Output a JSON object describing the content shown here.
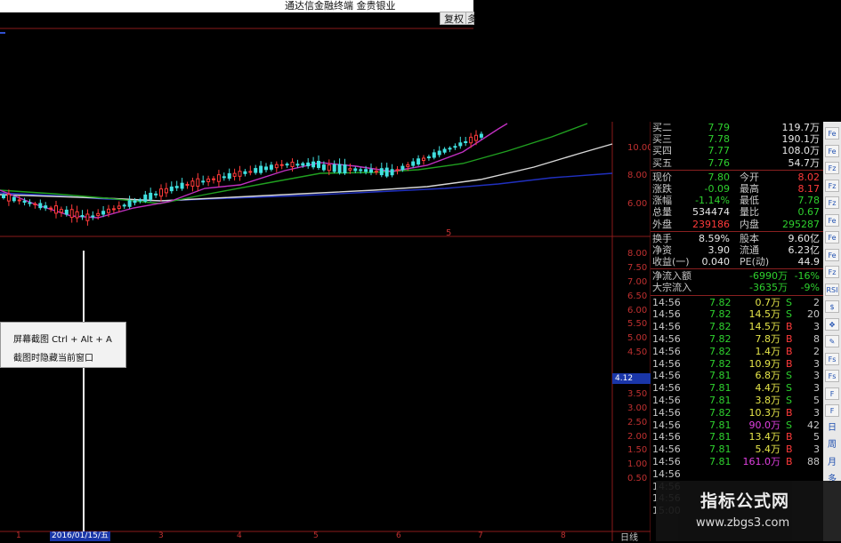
{
  "window": {
    "title": "通达信金融终端  金贵银业",
    "buttons": [
      "复权",
      "多"
    ]
  },
  "price_axis": [
    "10.00",
    "8.00",
    "6.00"
  ],
  "price_marker": "5",
  "lower_axis": [
    "8.00",
    "7.50",
    "7.00",
    "6.50",
    "6.00",
    "5.50",
    "5.00",
    "4.50",
    "4.12",
    "3.50",
    "3.00",
    "2.50",
    "2.00",
    "1.50",
    "1.00",
    "0.50"
  ],
  "bottom": {
    "date": "2016/01/15/五",
    "ticks": [
      "1",
      "3",
      "4",
      "5",
      "6",
      "7",
      "8"
    ],
    "period": "日线"
  },
  "context_menu": {
    "items": [
      "屏幕截图 Ctrl + Alt + A",
      "截图时隐藏当前窗口"
    ]
  },
  "quote": {
    "bids": [
      {
        "label": "买二",
        "price": "7.79",
        "vol": "119.7万"
      },
      {
        "label": "买三",
        "price": "7.78",
        "vol": "190.1万"
      },
      {
        "label": "买四",
        "price": "7.77",
        "vol": "108.0万"
      },
      {
        "label": "买五",
        "price": "7.76",
        "vol": "54.7万"
      }
    ],
    "stats": [
      {
        "l1": "现价",
        "v1": "7.80",
        "l2": "今开",
        "v2": "8.02"
      },
      {
        "l1": "涨跌",
        "v1": "-0.09",
        "l2": "最高",
        "v2": "8.17"
      },
      {
        "l1": "涨幅",
        "v1": "-1.14%",
        "l2": "最低",
        "v2": "7.78"
      },
      {
        "l1": "总量",
        "v1": "534474",
        "l2": "量比",
        "v2": "0.67"
      },
      {
        "l1": "外盘",
        "v1": "239186",
        "l2": "内盘",
        "v2": "295287"
      }
    ],
    "fundamentals": [
      {
        "l1": "换手",
        "v1": "8.59%",
        "l2": "股本",
        "v2": "9.60亿"
      },
      {
        "l1": "净资",
        "v1": "3.90",
        "l2": "流通",
        "v2": "6.23亿"
      },
      {
        "l1": "收益(一)",
        "v1": "0.040",
        "l2": "PE(动)",
        "v2": "44.9"
      }
    ],
    "flows": [
      {
        "label": "净流入额",
        "value": "-6990万",
        "pct": "-16%"
      },
      {
        "label": "大宗流入",
        "value": "-3635万",
        "pct": "-9%"
      }
    ]
  },
  "trades": [
    {
      "time": "14:56",
      "price": "7.82",
      "vol": "0.7万",
      "side": "S",
      "count": "2"
    },
    {
      "time": "14:56",
      "price": "7.82",
      "vol": "14.5万",
      "side": "S",
      "count": "20"
    },
    {
      "time": "14:56",
      "price": "7.82",
      "vol": "14.5万",
      "side": "B",
      "count": "3"
    },
    {
      "time": "14:56",
      "price": "7.82",
      "vol": "7.8万",
      "side": "B",
      "count": "8"
    },
    {
      "time": "14:56",
      "price": "7.82",
      "vol": "1.4万",
      "side": "B",
      "count": "2"
    },
    {
      "time": "14:56",
      "price": "7.82",
      "vol": "10.9万",
      "side": "B",
      "count": "3"
    },
    {
      "time": "14:56",
      "price": "7.81",
      "vol": "6.8万",
      "side": "S",
      "count": "3"
    },
    {
      "time": "14:56",
      "price": "7.81",
      "vol": "4.4万",
      "side": "S",
      "count": "3"
    },
    {
      "time": "14:56",
      "price": "7.81",
      "vol": "3.8万",
      "side": "S",
      "count": "5"
    },
    {
      "time": "14:56",
      "price": "7.82",
      "vol": "10.3万",
      "side": "B",
      "count": "3"
    },
    {
      "time": "14:56",
      "price": "7.81",
      "vol": "90.0万",
      "side": "S",
      "count": "42"
    },
    {
      "time": "14:56",
      "price": "7.81",
      "vol": "13.4万",
      "side": "B",
      "count": "5"
    },
    {
      "time": "14:56",
      "price": "7.81",
      "vol": "5.4万",
      "side": "B",
      "count": "3"
    },
    {
      "time": "14:56",
      "price": "7.81",
      "vol": "161.0万",
      "side": "B",
      "count": "88"
    },
    {
      "time": "14:56",
      "price": "",
      "vol": "",
      "side": "",
      "count": ""
    },
    {
      "time": "14:56",
      "price": "",
      "vol": "",
      "side": "",
      "count": ""
    },
    {
      "time": "14:56",
      "price": "",
      "vol": "",
      "side": "",
      "count": ""
    },
    {
      "time": "15:00",
      "price": "",
      "vol": "",
      "side": "",
      "count": ""
    }
  ],
  "toolbar": [
    "Fe",
    "Fe",
    "Fz",
    "Fz",
    "Fz",
    "Fe",
    "Fe",
    "Fe",
    "Fz",
    "RSI",
    "$",
    "✥",
    "✎",
    "Fs",
    "Fs",
    "F",
    "F",
    "日",
    "周",
    "月",
    "多"
  ],
  "watermark": {
    "title": "指标公式网",
    "url": "www.zbgs3.com"
  },
  "colors": {
    "up": "#ff3a3a",
    "down": "#2ed12e",
    "axis": "#c03030",
    "ma_white": "#d8d8d8",
    "ma_magenta": "#c030c0",
    "ma_green": "#20a020",
    "ma_blue": "#2030c0"
  }
}
